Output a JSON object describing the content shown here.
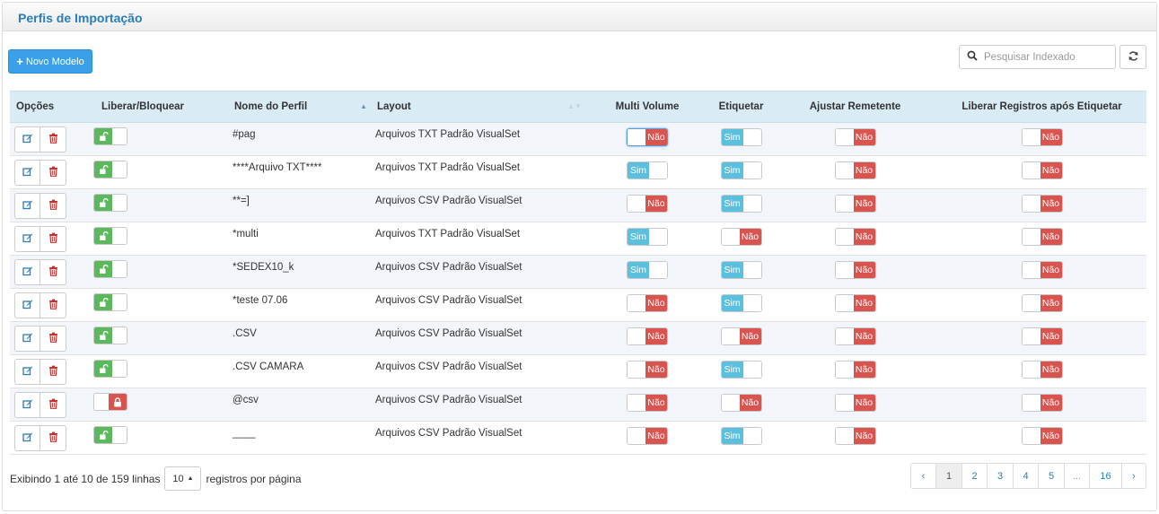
{
  "panel": {
    "title": "Perfis de Importação"
  },
  "toolbar": {
    "new_button_label": "Novo Modelo",
    "search_placeholder": "Pesquisar Indexado"
  },
  "columns": {
    "opcoes": "Opções",
    "liberar": "Liberar/Bloquear",
    "nome": "Nome do Perfil",
    "layout": "Layout",
    "multi_volume": "Multi Volume",
    "etiquetar": "Etiquetar",
    "ajustar": "Ajustar Remetente",
    "liberar_registros": "Liberar Registros após Etiquetar"
  },
  "toggle_labels": {
    "yes": "Sim",
    "no": "Não"
  },
  "rows": [
    {
      "nome": "#pag",
      "layout": "Arquivos TXT Padrão VisualSet",
      "unlocked": true,
      "multi": false,
      "etiq": true,
      "ajustar": false,
      "liberar": false
    },
    {
      "nome": "****Arquivo TXT****",
      "layout": "Arquivos TXT Padrão VisualSet",
      "unlocked": true,
      "multi": true,
      "etiq": true,
      "ajustar": false,
      "liberar": false
    },
    {
      "nome": "**=]",
      "layout": "Arquivos CSV Padrão VisualSet",
      "unlocked": true,
      "multi": false,
      "etiq": true,
      "ajustar": false,
      "liberar": false
    },
    {
      "nome": "*multi",
      "layout": "Arquivos TXT Padrão VisualSet",
      "unlocked": true,
      "multi": true,
      "etiq": false,
      "ajustar": false,
      "liberar": false
    },
    {
      "nome": "*SEDEX10_k",
      "layout": "Arquivos CSV Padrão VisualSet",
      "unlocked": true,
      "multi": true,
      "etiq": true,
      "ajustar": false,
      "liberar": false
    },
    {
      "nome": "*teste 07.06",
      "layout": "Arquivos CSV Padrão VisualSet",
      "unlocked": true,
      "multi": false,
      "etiq": true,
      "ajustar": false,
      "liberar": false
    },
    {
      "nome": ".CSV",
      "layout": "Arquivos CSV Padrão VisualSet",
      "unlocked": true,
      "multi": false,
      "etiq": false,
      "ajustar": false,
      "liberar": false
    },
    {
      "nome": ".CSV CAMARA",
      "layout": "Arquivos CSV Padrão VisualSet",
      "unlocked": true,
      "multi": false,
      "etiq": true,
      "ajustar": false,
      "liberar": false
    },
    {
      "nome": "@csv",
      "layout": "Arquivos CSV Padrão VisualSet",
      "unlocked": false,
      "multi": false,
      "etiq": false,
      "ajustar": false,
      "liberar": false
    },
    {
      "nome": "____",
      "layout": "Arquivos CSV Padrão VisualSet",
      "unlocked": true,
      "multi": false,
      "etiq": true,
      "ajustar": false,
      "liberar": false
    }
  ],
  "footer": {
    "showing_text": "Exibindo 1 até 10 de 159 linhas",
    "page_size": "10",
    "per_page_text": "registros por página"
  },
  "pagination": {
    "prev": "‹",
    "pages": [
      "1",
      "2",
      "3",
      "4",
      "5",
      "...",
      "16"
    ],
    "next": "›"
  },
  "colors": {
    "accent": "#3aa0e8",
    "yes": "#5bc0de",
    "no": "#d9534f",
    "unlocked": "#5cb85c",
    "header_bg": "#d9ebf5"
  }
}
